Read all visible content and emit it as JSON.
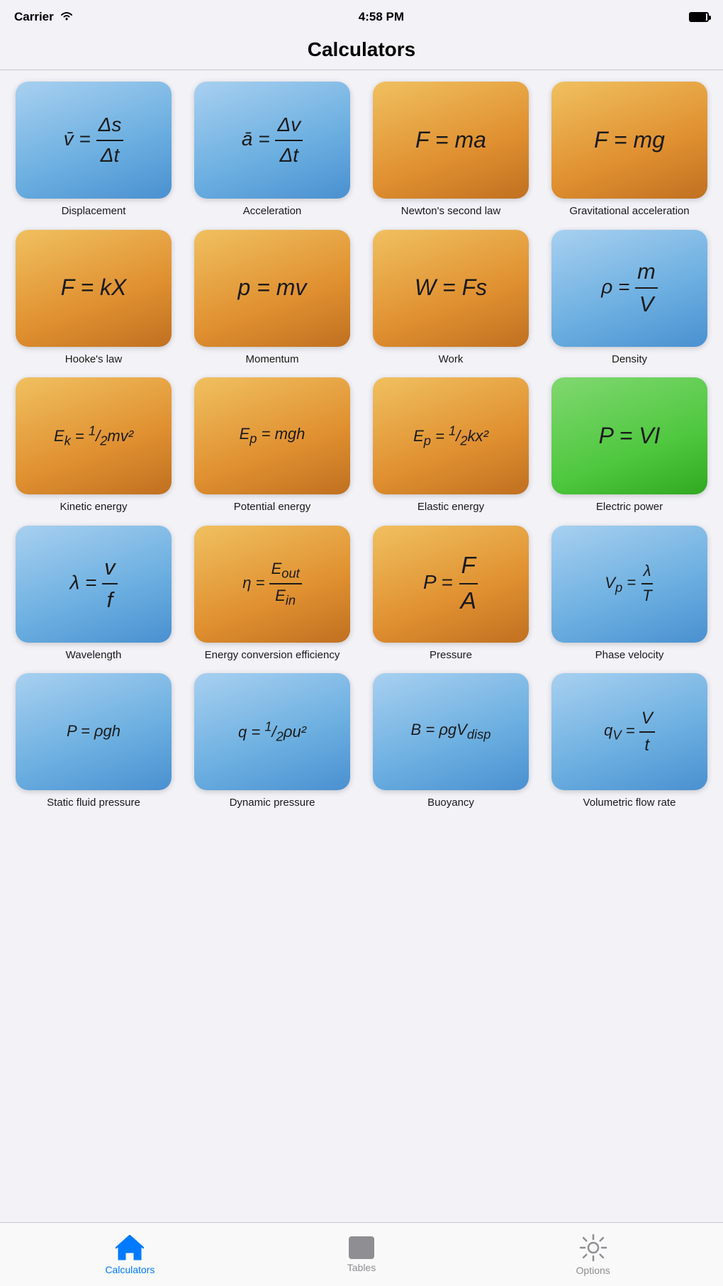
{
  "statusBar": {
    "carrier": "Carrier",
    "time": "4:58 PM"
  },
  "header": {
    "title": "Calculators"
  },
  "calculators": [
    {
      "id": "displacement",
      "formula_html": "<span style='font-style:italic'>v̄</span> = <span class='fraction'><span class='num'>Δs</span><span class='den'>Δt</span></span>",
      "label": "Displacement",
      "color": "blue"
    },
    {
      "id": "acceleration",
      "formula_html": "<span style='font-style:italic'>ā</span> = <span class='fraction'><span class='num'>Δv</span><span class='den'>Δt</span></span>",
      "label": "Acceleration",
      "color": "blue"
    },
    {
      "id": "newtons-second",
      "formula_html": "<span style='font-style:italic'>F</span> = <span style='font-style:italic'>ma</span>",
      "label": "Newton's second law",
      "color": "orange"
    },
    {
      "id": "gravitational",
      "formula_html": "<span style='font-style:italic'>F</span> = <span style='font-style:italic'>mg</span>",
      "label": "Gravitational acceleration",
      "color": "orange"
    },
    {
      "id": "hookes-law",
      "formula_html": "<span style='font-style:italic'>F</span> = <span style='font-style:italic'>kX</span>",
      "label": "Hooke's law",
      "color": "orange"
    },
    {
      "id": "momentum",
      "formula_html": "<span style='font-style:italic'>p</span> = <span style='font-style:italic'>mv</span>",
      "label": "Momentum",
      "color": "orange"
    },
    {
      "id": "work",
      "formula_html": "<span style='font-style:italic'>W</span> = <span style='font-style:italic'>Fs</span>",
      "label": "Work",
      "color": "orange"
    },
    {
      "id": "density",
      "formula_html": "<span style='font-style:italic'>ρ</span> = <span class='fraction'><span class='num'><em>m</em></span><span class='den'><em>V</em></span></span>",
      "label": "Density",
      "color": "blue"
    },
    {
      "id": "kinetic-energy",
      "formula_html": "<span style='font-style:italic'>E<sub>k</sub></span> = <span style='font-style:italic'><sup>1</sup>/<sub>2</sub>mv²</span>",
      "label": "Kinetic energy",
      "color": "orange"
    },
    {
      "id": "potential-energy",
      "formula_html": "<span style='font-style:italic'>E<sub>p</sub></span> = <span style='font-style:italic'>mgh</span>",
      "label": "Potential energy",
      "color": "orange"
    },
    {
      "id": "elastic-energy",
      "formula_html": "<span style='font-style:italic'>E<sub>p</sub></span> = <span style='font-style:italic'><sup>1</sup>/<sub>2</sub>kx²</span>",
      "label": "Elastic energy",
      "color": "orange"
    },
    {
      "id": "electric-power",
      "formula_html": "<span style='font-style:italic'>P</span> = <span style='font-style:italic'>VI</span>",
      "label": "Electric power",
      "color": "green"
    },
    {
      "id": "wavelength",
      "formula_html": "<span style='font-style:italic'>λ</span> = <span class='fraction'><span class='num'><em>v</em></span><span class='den'><em>f</em></span></span>",
      "label": "Wavelength",
      "color": "blue"
    },
    {
      "id": "energy-conversion",
      "formula_html": "<span style='font-style:italic'>η</span> = <span class='fraction'><span class='num'><em>E<sub>out</sub></em></span><span class='den'><em>E<sub>in</sub></em></span></span>",
      "label": "Energy conversion efficiency",
      "color": "orange"
    },
    {
      "id": "pressure",
      "formula_html": "<span style='font-style:italic'>P</span> = <span class='fraction'><span class='num'><em>F</em></span><span class='den'><em>A</em></span></span>",
      "label": "Pressure",
      "color": "orange"
    },
    {
      "id": "phase-velocity",
      "formula_html": "<span style='font-style:italic'>V<sub>p</sub></span> = <span class='fraction'><span class='num'><em>λ</em></span><span class='den'><em>T</em></span></span>",
      "label": "Phase velocity",
      "color": "blue"
    },
    {
      "id": "static-fluid",
      "formula_html": "<span style='font-style:italic'>P</span> = <span style='font-style:italic'>ρgh</span>",
      "label": "Static fluid pressure",
      "color": "blue"
    },
    {
      "id": "dynamic-pressure",
      "formula_html": "<span style='font-style:italic'>q</span> = <span style='font-style:italic'><sup>1</sup>/<sub>2</sub>ρu²</span>",
      "label": "Dynamic pressure",
      "color": "blue"
    },
    {
      "id": "buoyancy",
      "formula_html": "<span style='font-style:italic'>B</span> = <span style='font-style:italic'>ρgV<sub>disp</sub></span>",
      "label": "Buoyancy",
      "color": "blue"
    },
    {
      "id": "volumetric-flow",
      "formula_html": "<span style='font-style:italic'>q<sub>V</sub></span> = <span class='fraction'><span class='num'><em>V</em></span><span class='den'><em>t</em></span></span>",
      "label": "Volumetric flow rate",
      "color": "blue"
    }
  ],
  "tabBar": {
    "tabs": [
      {
        "id": "calculators",
        "label": "Calculators",
        "active": true
      },
      {
        "id": "tables",
        "label": "Tables",
        "active": false
      },
      {
        "id": "options",
        "label": "Options",
        "active": false
      }
    ]
  }
}
